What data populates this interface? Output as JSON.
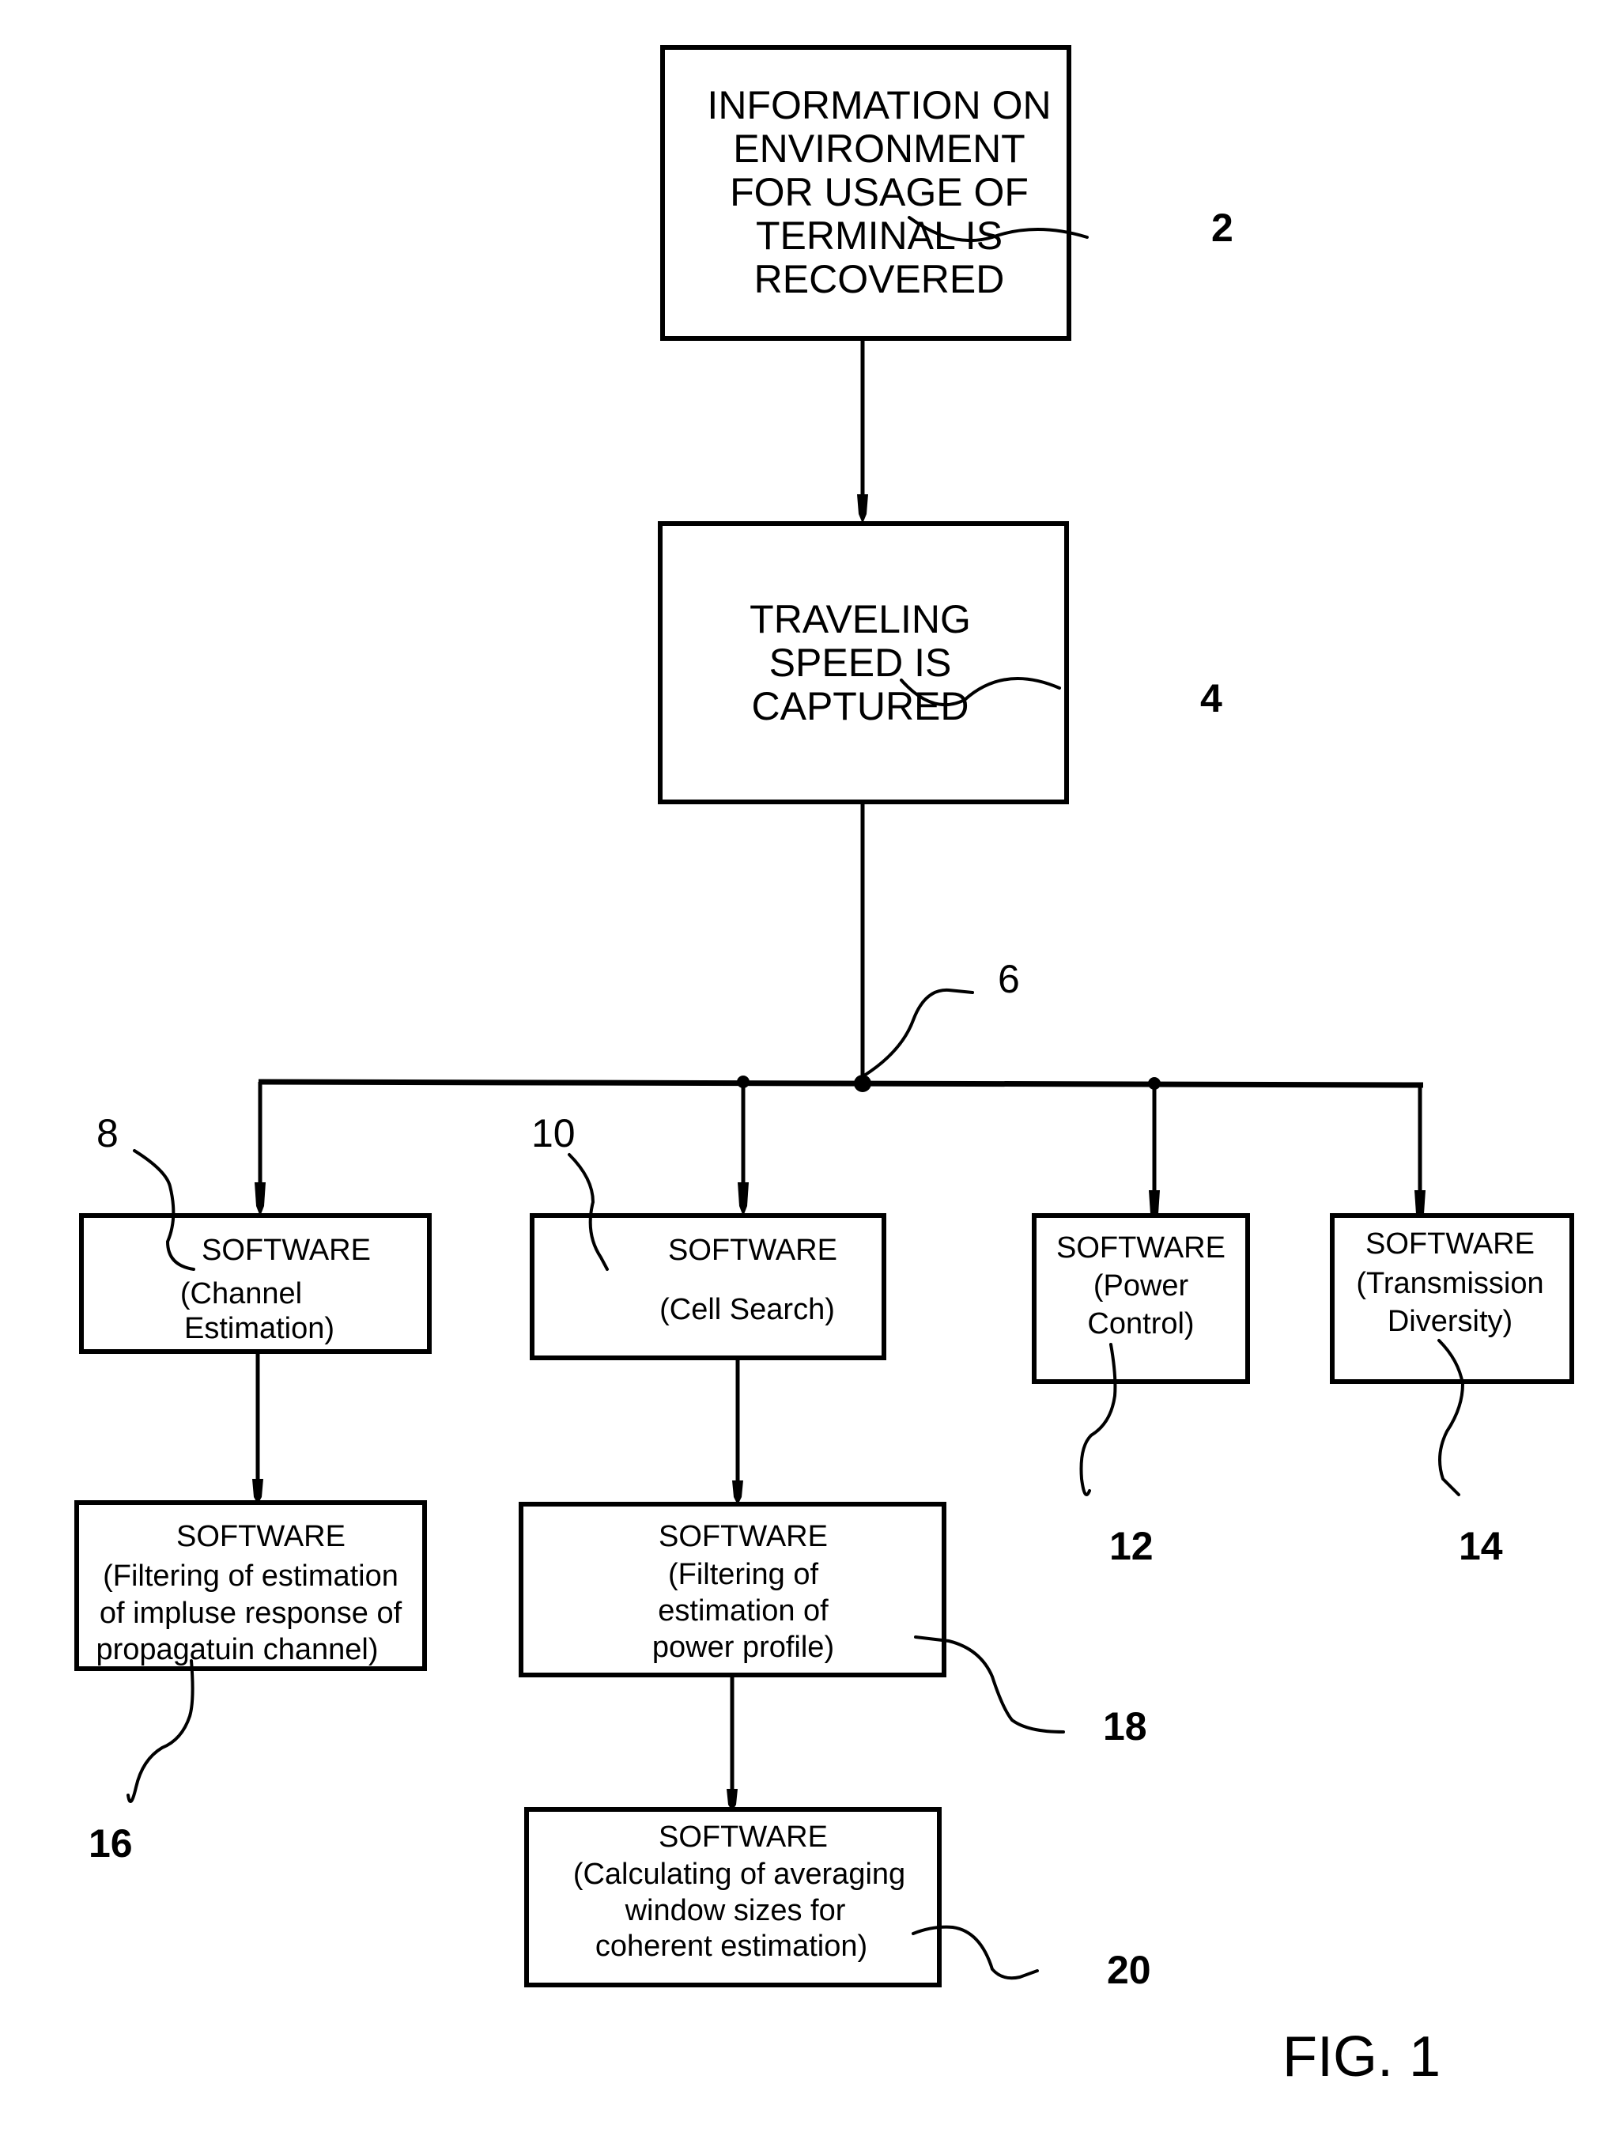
{
  "figure": {
    "label": "FIG. 1",
    "type": "patent flowchart"
  },
  "nodes": {
    "n2": {
      "ref": "2",
      "lines": [
        "INFORMATION ON",
        "ENVIRONMENT",
        "FOR USAGE OF",
        "TERMINAL IS",
        "RECOVERED"
      ]
    },
    "n4": {
      "ref": "4",
      "lines": [
        "TRAVELING",
        "SPEED IS",
        "CAPTURED"
      ]
    },
    "n6": {
      "ref": "6"
    },
    "n8": {
      "ref": "8",
      "lines": [
        "SOFTWARE",
        "(Channel",
        "Estimation)"
      ]
    },
    "n10": {
      "ref": "10",
      "lines": [
        "SOFTWARE",
        "(Cell Search)"
      ]
    },
    "n12": {
      "ref": "12",
      "lines": [
        "SOFTWARE",
        "(Power",
        "Control)"
      ]
    },
    "n14": {
      "ref": "14",
      "lines": [
        "SOFTWARE",
        "(Transmission",
        "Diversity)"
      ]
    },
    "n16": {
      "ref": "16",
      "lines": [
        "SOFTWARE",
        "(Filtering of estimation",
        "of impluse response of",
        "propagatuin channel)"
      ]
    },
    "n18": {
      "ref": "18",
      "lines": [
        "SOFTWARE",
        "(Filtering of",
        "estimation of",
        "power profile)"
      ]
    },
    "n20": {
      "ref": "20",
      "lines": [
        "SOFTWARE",
        "(Calculating of averaging",
        "window sizes for",
        "coherent estimation)"
      ]
    }
  },
  "edges": [
    {
      "from": "2",
      "to": "4"
    },
    {
      "from": "4",
      "to": "6"
    },
    {
      "from": "6",
      "to": "8"
    },
    {
      "from": "6",
      "to": "10"
    },
    {
      "from": "6",
      "to": "12"
    },
    {
      "from": "6",
      "to": "14"
    },
    {
      "from": "8",
      "to": "16"
    },
    {
      "from": "10",
      "to": "18"
    },
    {
      "from": "18",
      "to": "20"
    }
  ]
}
